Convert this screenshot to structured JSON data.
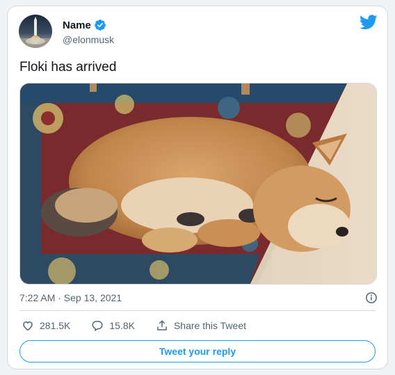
{
  "user": {
    "name": "Name",
    "handle": "@elonmusk",
    "verified": true
  },
  "tweet": {
    "text": "Floki has arrived",
    "image_alt": "shiba-inu-puppy-sleeping-on-rug",
    "timestamp": "7:22 AM · Sep 13, 2021"
  },
  "stats": {
    "likes": "281.5K",
    "replies": "15.8K",
    "share_label": "Share this Tweet"
  },
  "reply_button_label": "Tweet your reply",
  "colors": {
    "accent": "#1d9bf0",
    "text": "#0f1419",
    "muted": "#536471",
    "border": "#cfd9de"
  },
  "icons": {
    "logo": "twitter-bird-icon",
    "verified": "verified-badge-icon",
    "info": "info-icon",
    "like": "heart-icon",
    "reply": "reply-bubble-icon",
    "share": "share-icon"
  }
}
